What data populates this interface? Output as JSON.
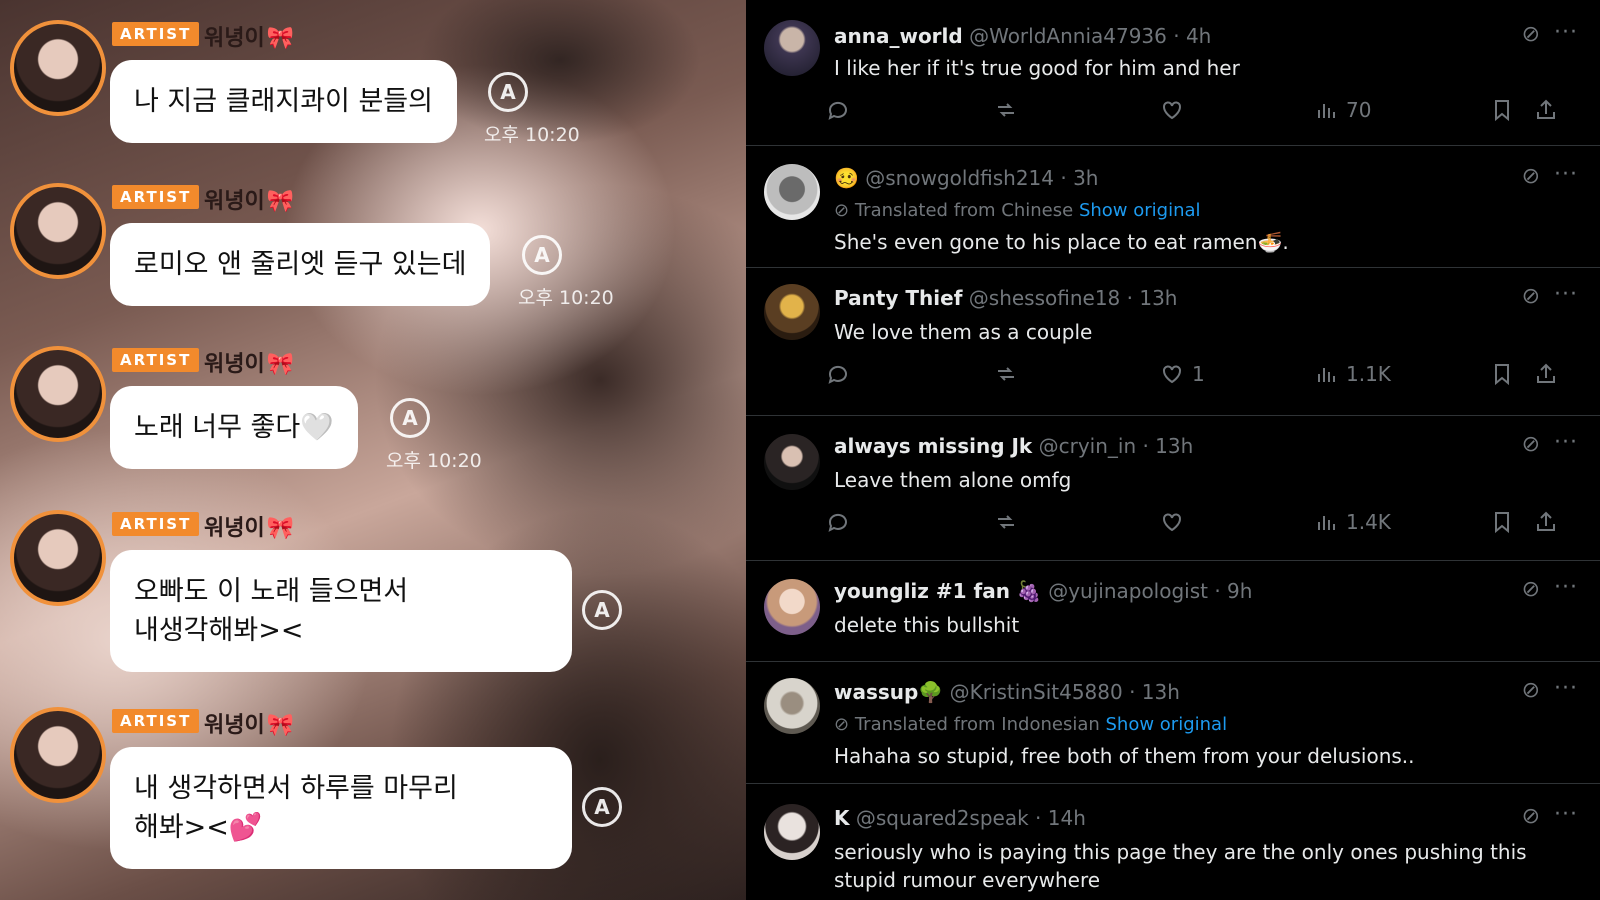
{
  "chat": {
    "badge": "ARTIST",
    "messages": [
      {
        "nick": "워녕이",
        "text": "나 지금 클래지콰이 분들의",
        "time": "오후 10:20"
      },
      {
        "nick": "워녕이",
        "text": "로미오 앤 줄리엣 듣구 있는데",
        "time": "오후 10:20"
      },
      {
        "nick": "워녕이",
        "text": "노래 너무 좋다🤍",
        "time": "오후 10:20"
      },
      {
        "nick": "워녕이",
        "text": "오빠도 이 노래 들으면서\n내생각해봐><",
        "time": ""
      },
      {
        "nick": "워녕이",
        "text": "내 생각하면서 하루를 마무리\n해봐><💕",
        "time": ""
      }
    ],
    "bow": "🎀",
    "auto_icon": "A"
  },
  "posts": [
    {
      "name": "anna_world",
      "handle": "@WorldAnnia47936 · 4h",
      "text": "I like her if it's true good for him and her",
      "likes": "",
      "views": "70"
    },
    {
      "name": "🥴",
      "handle": "@snowgoldfish214 · 3h",
      "translated": "Translated from Chinese",
      "show_original": "Show original",
      "text": "She's even gone to his place to eat ramen🍜."
    },
    {
      "name": "Panty Thief",
      "handle": "@shessofine18 · 13h",
      "text": "We love them as a couple",
      "likes": "1",
      "views": "1.1K"
    },
    {
      "name": "always missing Jk",
      "handle": "@cryin_in · 13h",
      "text": "Leave them alone omfg",
      "likes": "",
      "views": "1.4K"
    },
    {
      "name": "youngliz #1 fan 🍇",
      "handle": "@yujinapologist · 9h",
      "text": "delete this bullshit"
    },
    {
      "name": "wassup🌳",
      "handle": "@KristinSit45880 · 13h",
      "translated": "Translated from Indonesian",
      "show_original": "Show original",
      "text": "Hahaha so stupid, free both of them from your delusions.."
    },
    {
      "name": "K",
      "handle": "@squared2speak · 14h",
      "text": "seriously who is paying this page they are the only ones pushing this stupid rumour everywhere"
    }
  ],
  "icons": {
    "grok": "grok-icon",
    "more": "···"
  },
  "colors": {
    "badge": "#f28a2c",
    "avatar_ring": "#f0913b",
    "link": "#1d9bf0",
    "muted": "#71767b"
  }
}
